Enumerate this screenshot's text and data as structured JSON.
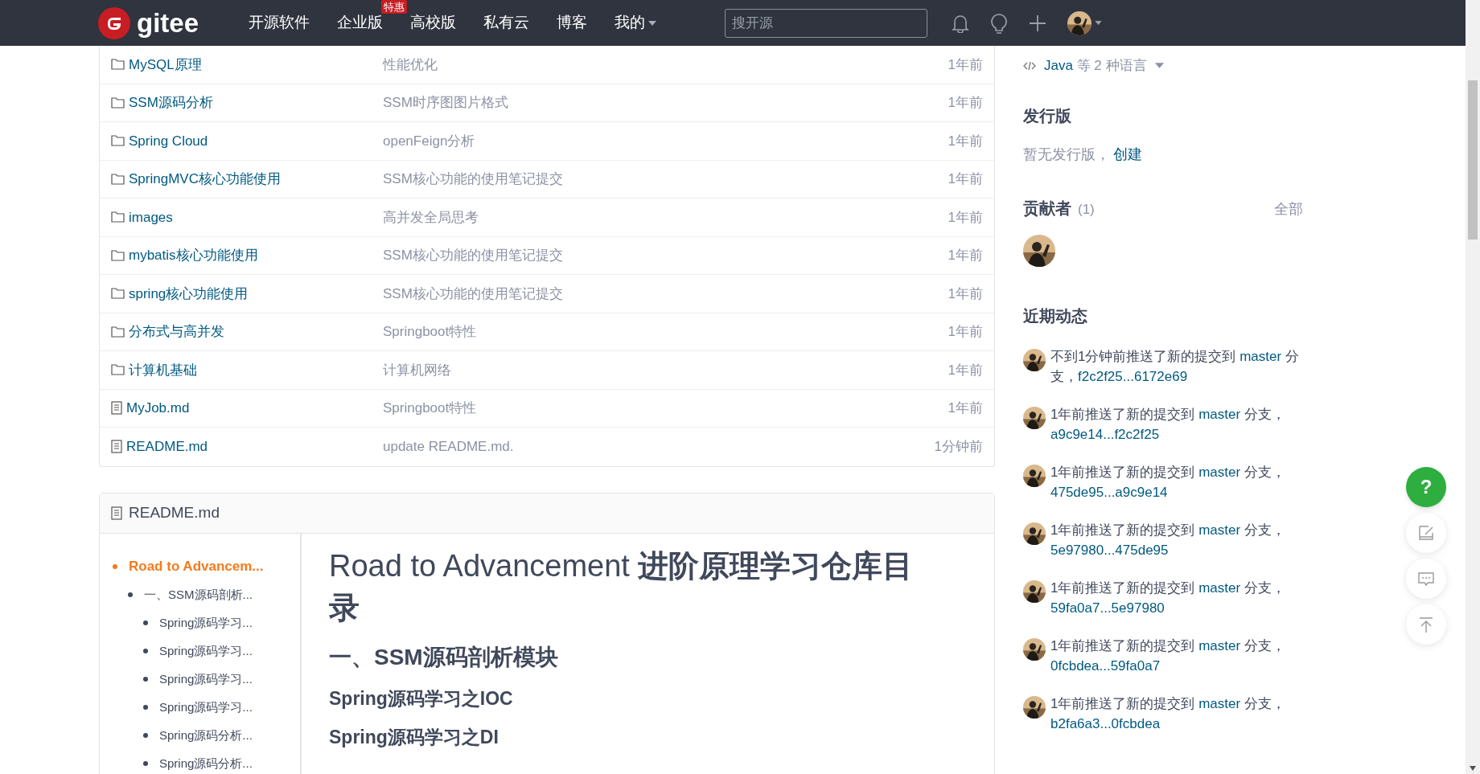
{
  "nav": {
    "brand": "gitee",
    "items": [
      {
        "label": "开源软件"
      },
      {
        "label": "企业版",
        "badge": "特惠"
      },
      {
        "label": "高校版"
      },
      {
        "label": "私有云"
      },
      {
        "label": "博客"
      },
      {
        "label": "我的",
        "dropdown": true
      }
    ],
    "search": {
      "placeholder": "搜开源"
    }
  },
  "files": [
    {
      "kind": "folder",
      "name": "MySQL原理",
      "message": "性能优化",
      "time": "1年前"
    },
    {
      "kind": "folder",
      "name": "SSM源码分析",
      "message": "SSM时序图图片格式",
      "time": "1年前"
    },
    {
      "kind": "folder",
      "name": "Spring Cloud",
      "message": "openFeign分析",
      "time": "1年前"
    },
    {
      "kind": "folder",
      "name": "SpringMVC核心功能使用",
      "message": "SSM核心功能的使用笔记提交",
      "time": "1年前"
    },
    {
      "kind": "folder",
      "name": "images",
      "message": "高并发全局思考",
      "time": "1年前"
    },
    {
      "kind": "folder",
      "name": "mybatis核心功能使用",
      "message": "SSM核心功能的使用笔记提交",
      "time": "1年前"
    },
    {
      "kind": "folder",
      "name": "spring核心功能使用",
      "message": "SSM核心功能的使用笔记提交",
      "time": "1年前"
    },
    {
      "kind": "folder",
      "name": "分布式与高并发",
      "message": "Springboot特性",
      "time": "1年前"
    },
    {
      "kind": "folder",
      "name": "计算机基础",
      "message": "计算机网络",
      "time": "1年前"
    },
    {
      "kind": "file",
      "name": "MyJob.md",
      "message": "Springboot特性",
      "time": "1年前"
    },
    {
      "kind": "file",
      "name": "README.md",
      "message": "update README.md.",
      "time": "1分钟前"
    }
  ],
  "readme": {
    "title": "README.md",
    "toc": [
      {
        "label": "Road to Advancem...",
        "selected": true,
        "children": [
          {
            "label": "一、SSM源码剖析...",
            "selected": false,
            "children": [
              {
                "label": "Spring源码学习...",
                "selected": false
              },
              {
                "label": "Spring源码学习...",
                "selected": false
              },
              {
                "label": "Spring源码学习...",
                "selected": false
              },
              {
                "label": "Spring源码学习...",
                "selected": false
              },
              {
                "label": "Spring源码分析...",
                "selected": false
              },
              {
                "label": "Spring源码分析...",
                "selected": false
              }
            ]
          }
        ]
      }
    ],
    "content": [
      {
        "kind": "h1",
        "text": "Road to Advancement **进阶原理学习仓库目录**"
      },
      {
        "kind": "h2",
        "text": "一、SSM源码剖析模块"
      },
      {
        "kind": "h3",
        "text": "Spring源码学习之IOC"
      },
      {
        "kind": "h3",
        "text": "Spring源码学习之DI"
      }
    ]
  },
  "sidebar": {
    "language": {
      "name": "Java",
      "rest": "等 2 种语言"
    },
    "releases": {
      "title": "发行版",
      "empty": "暂无发行版，",
      "link": "创建"
    },
    "contributors": {
      "title": "贡献者",
      "count": "(1)",
      "all": "全部"
    },
    "activity": {
      "title": "近期动态",
      "items": [
        {
          "text": "不到1分钟前推送了新的提交到 ",
          "branch": "master",
          "middle": " 分支，",
          "commits": "f2c2f25...6172e69"
        },
        {
          "text": "1年前推送了新的提交到 ",
          "branch": "master",
          "middle": " 分支，",
          "commits": "a9c9e14...f2c2f25"
        },
        {
          "text": "1年前推送了新的提交到 ",
          "branch": "master",
          "middle": " 分支，",
          "commits": "475de95...a9c9e14"
        },
        {
          "text": "1年前推送了新的提交到 ",
          "branch": "master",
          "middle": " 分支，",
          "commits": "5e97980...475de95"
        },
        {
          "text": "1年前推送了新的提交到 ",
          "branch": "master",
          "middle": " 分支，",
          "commits": "59fa0a7...5e97980"
        },
        {
          "text": "1年前推送了新的提交到 ",
          "branch": "master",
          "middle": " 分支，",
          "commits": "0fcbdea...59fa0a7"
        },
        {
          "text": "1年前推送了新的提交到 ",
          "branch": "master",
          "middle": " 分支，",
          "commits": "b2fa6a3...0fcbdea"
        }
      ]
    }
  },
  "float_buttons": [
    {
      "kind": "help",
      "label": "?"
    },
    {
      "kind": "edit"
    },
    {
      "kind": "comment"
    },
    {
      "kind": "top"
    }
  ]
}
